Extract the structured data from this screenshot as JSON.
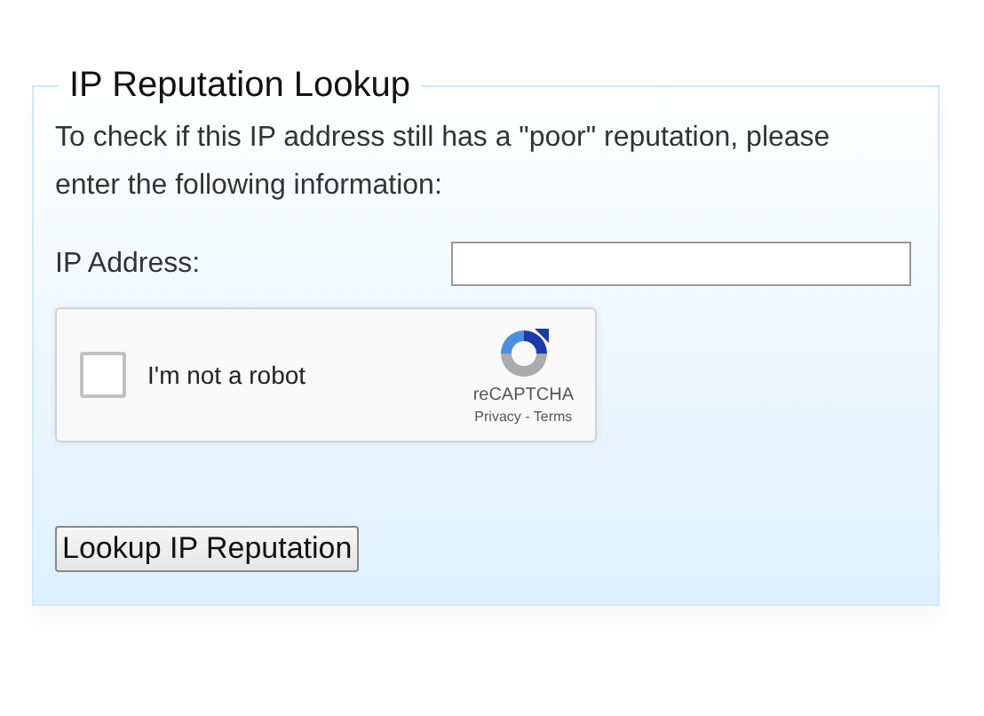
{
  "form": {
    "title": "IP Reputation Lookup",
    "intro": "To check if this IP address still has a \"poor\" reputation, please enter the following information:",
    "ip_label": "IP Address:",
    "captcha": {
      "label": "I'm not a robot",
      "checked": false,
      "brand": "reCAPTCHA",
      "links": "Privacy - Terms"
    },
    "submit": "Lookup IP Reputation"
  }
}
